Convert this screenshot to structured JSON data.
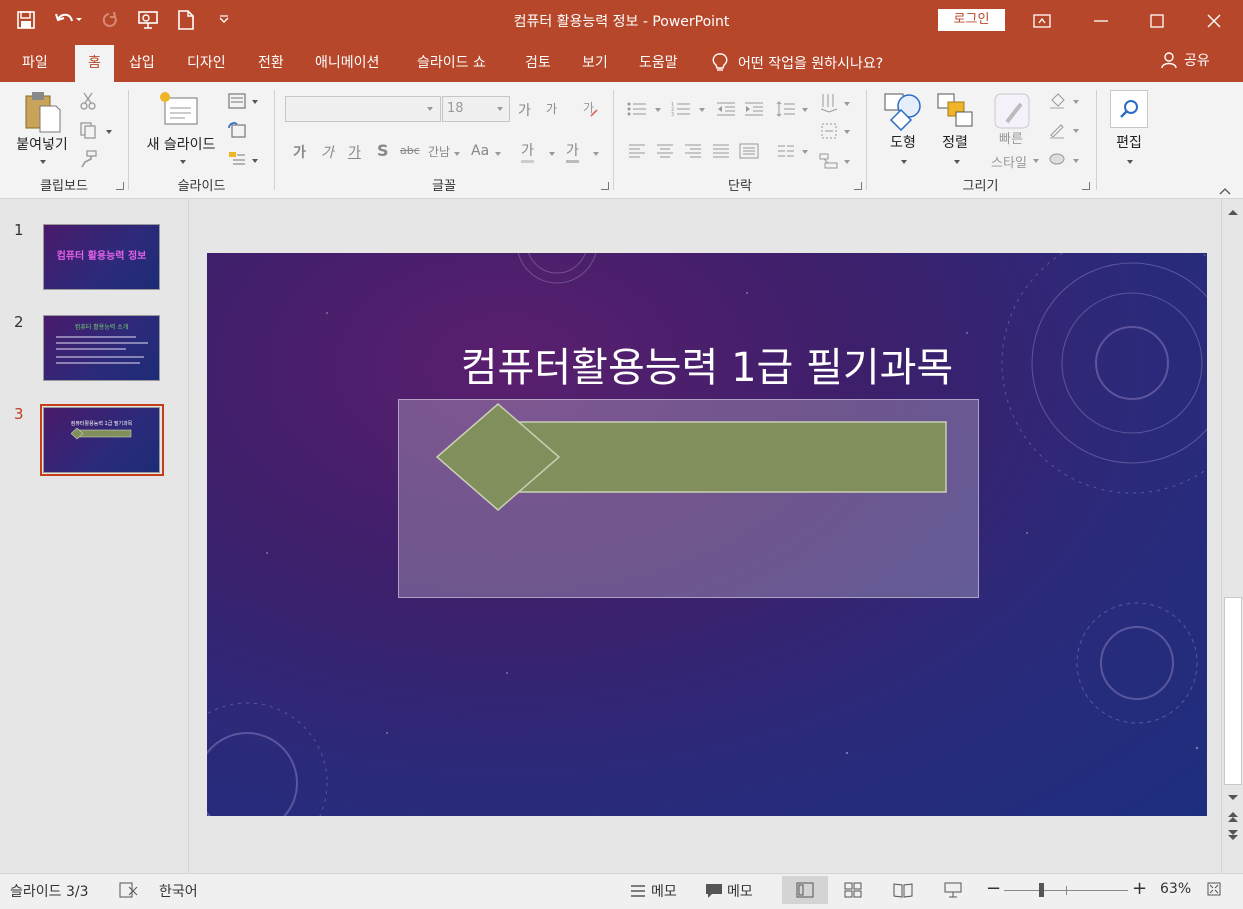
{
  "title_bar": {
    "window_title": "컴퓨터 활용능력 정보  -  PowerPoint",
    "login_label": "로그인",
    "qat_icons": [
      "save-icon",
      "undo-icon",
      "redo-icon",
      "present-from-start-icon",
      "new-file-icon",
      "customize-qat-icon"
    ]
  },
  "menu": {
    "tabs": [
      "파일",
      "홈",
      "삽입",
      "디자인",
      "전환",
      "애니메이션",
      "슬라이드 쇼",
      "검토",
      "보기",
      "도움말"
    ],
    "active_tab": "홈",
    "tell_me": "어떤 작업을 원하시나요?",
    "share": "공유"
  },
  "ribbon": {
    "clipboard": {
      "label": "클립보드",
      "paste": "붙여넣기"
    },
    "slides": {
      "label": "슬라이드",
      "new_slide": "새 슬라이드"
    },
    "font": {
      "label": "글꼴",
      "font_name": "",
      "font_size": "18",
      "bold": "가",
      "italic": "가",
      "underline": "가",
      "shadow": "S",
      "strike": "abc",
      "spacing": "간남",
      "case": "Aa",
      "highlight": "가",
      "color": "가",
      "grow": "가",
      "shrink": "가"
    },
    "paragraph": {
      "label": "단락"
    },
    "drawing": {
      "label": "그리기",
      "shapes": "도형",
      "arrange": "정렬",
      "quick_styles_1": "빠른",
      "quick_styles_2": "스타일"
    },
    "editing": {
      "label": "편집"
    }
  },
  "thumbnails": [
    {
      "number": "1",
      "title": "컴퓨터 활용능력 정보"
    },
    {
      "number": "2",
      "title": "컴퓨터 활용능력 소개"
    },
    {
      "number": "3",
      "title": "컴퓨터활용능력 1급 필기과목",
      "selected": true
    }
  ],
  "slide": {
    "title": "컴퓨터활용능력 1급 필기과목",
    "shape_fill": "#818f5d",
    "shape_stroke": "#c9d0b4"
  },
  "status": {
    "slide_info": "슬라이드 3/3",
    "language": "한국어",
    "notes": "메모",
    "comments": "메모",
    "zoom": "63%"
  },
  "colors": {
    "accent": "#b7472a",
    "selected": "#c43e1c"
  }
}
